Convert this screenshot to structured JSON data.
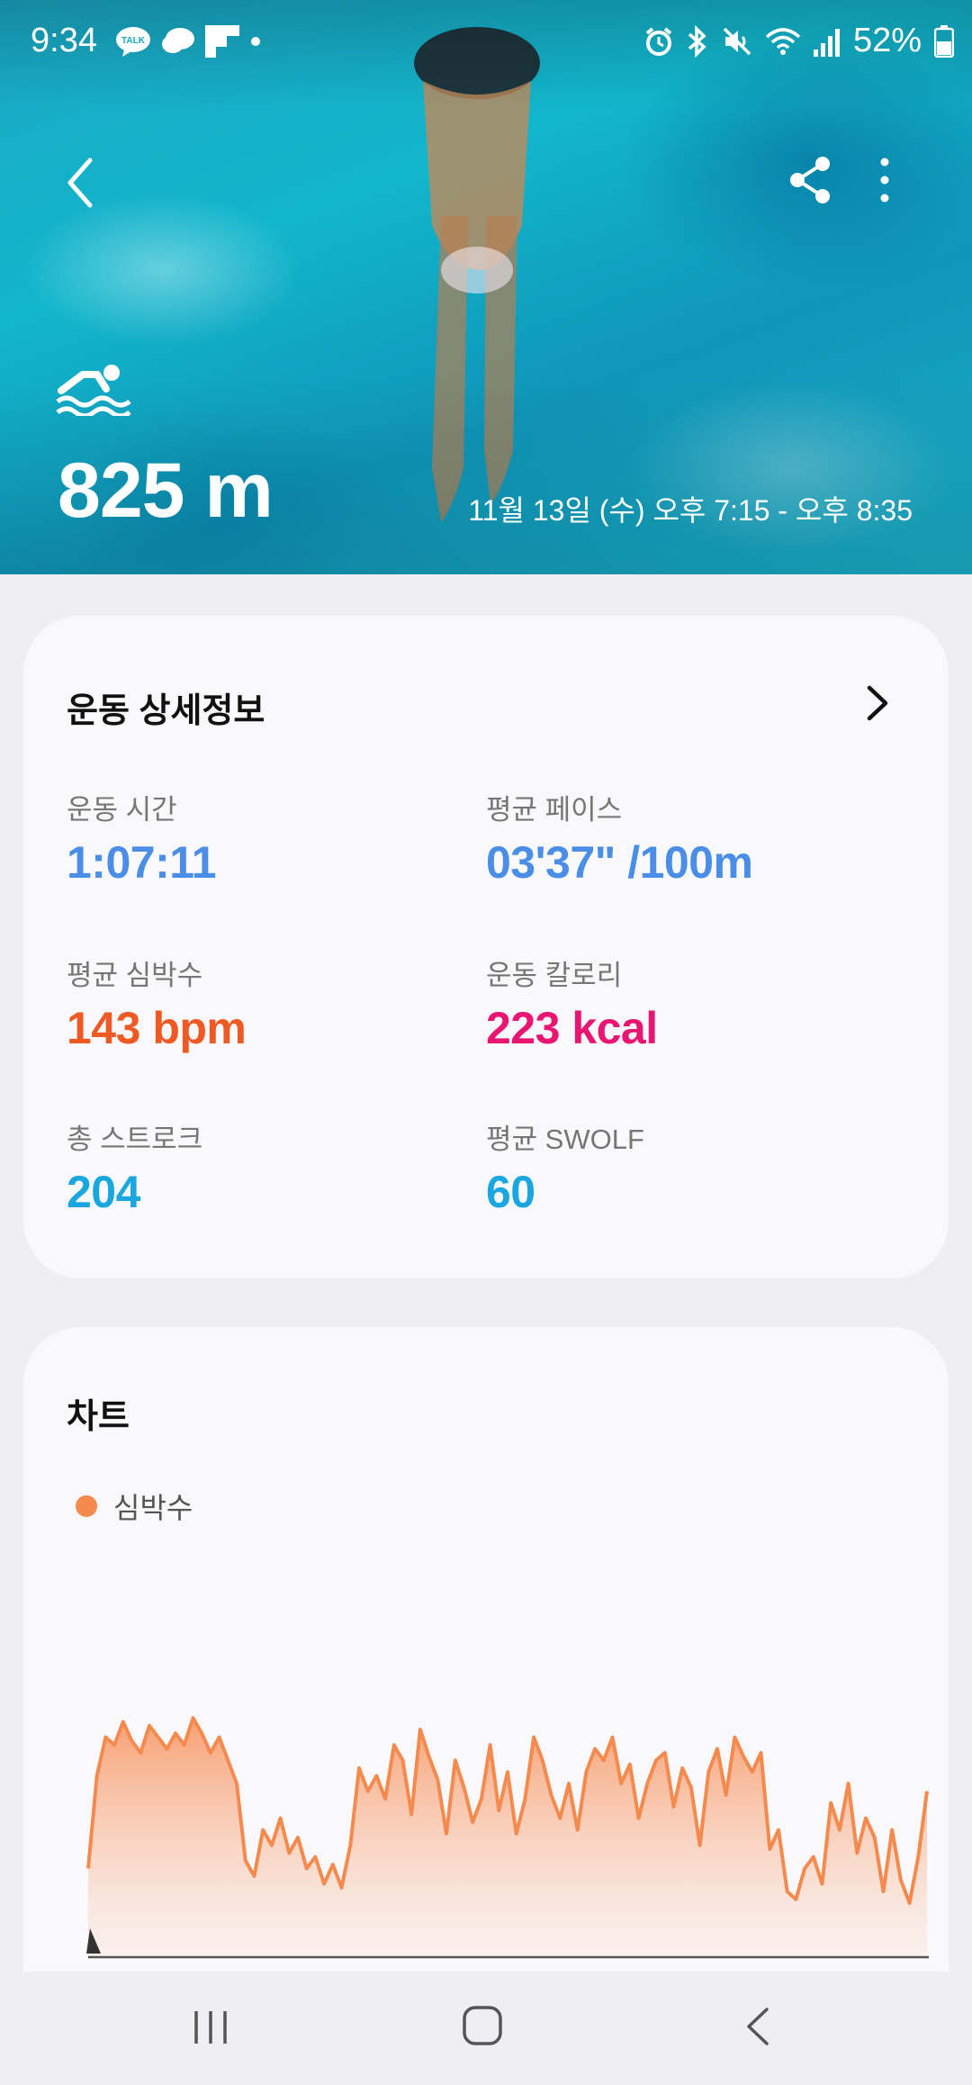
{
  "status": {
    "time": "9:34",
    "battery": "52%",
    "left_icons": [
      "talk-icon",
      "chat-icon",
      "flipboard-icon",
      "dot-icon"
    ],
    "right_icons": [
      "alarm-icon",
      "bluetooth-icon",
      "mute-icon",
      "wifi-icon",
      "signal-icon",
      "battery-icon"
    ]
  },
  "hero": {
    "distance": "825 m",
    "datetime": "11월 13일 (수) 오후 7:15 - 오후 8:35",
    "activity_icon": "swimming-icon"
  },
  "details": {
    "title": "운동 상세정보",
    "metrics": [
      {
        "label": "운동 시간",
        "value": "1:07:11",
        "color": "#4a8ee8"
      },
      {
        "label": "평균 페이스",
        "value": "03'37\" /100m",
        "color": "#4a8ee8"
      },
      {
        "label": "평균 심박수",
        "value": "143 bpm",
        "color": "#ef5a24"
      },
      {
        "label": "운동 칼로리",
        "value": "223 kcal",
        "color": "#e91573"
      },
      {
        "label": "총 스트로크",
        "value": "204",
        "color": "#1aa7e0"
      },
      {
        "label": "평균 SWOLF",
        "value": "60",
        "color": "#1aa7e0"
      }
    ]
  },
  "chart": {
    "title": "차트",
    "legend": "심박수"
  },
  "chart_data": {
    "type": "area",
    "title": "",
    "xlabel": "",
    "ylabel": "",
    "series": [
      {
        "name": "심박수",
        "color": "#f58a4e",
        "values": [
          118,
          142,
          152,
          150,
          156,
          151,
          148,
          155,
          152,
          149,
          153,
          150,
          157,
          153,
          148,
          152,
          146,
          140,
          120,
          116,
          128,
          124,
          131,
          122,
          126,
          118,
          121,
          114,
          119,
          113,
          124,
          144,
          138,
          142,
          136,
          150,
          146,
          132,
          154,
          147,
          141,
          127,
          146,
          139,
          130,
          136,
          150,
          133,
          143,
          127,
          136,
          152,
          146,
          137,
          131,
          140,
          128,
          143,
          149,
          146,
          152,
          140,
          145,
          131,
          140,
          146,
          148,
          134,
          144,
          139,
          124,
          143,
          149,
          137,
          152,
          147,
          143,
          148,
          123,
          128,
          112,
          110,
          118,
          121,
          114,
          135,
          128,
          140,
          122,
          131,
          126,
          112,
          128,
          115,
          109,
          121,
          138
        ]
      }
    ],
    "ylim": [
      95,
      165
    ],
    "grid": false,
    "legend_position": "top-left"
  },
  "nav": {
    "recents": "recents-icon",
    "home": "home-icon",
    "back": "back-icon"
  }
}
